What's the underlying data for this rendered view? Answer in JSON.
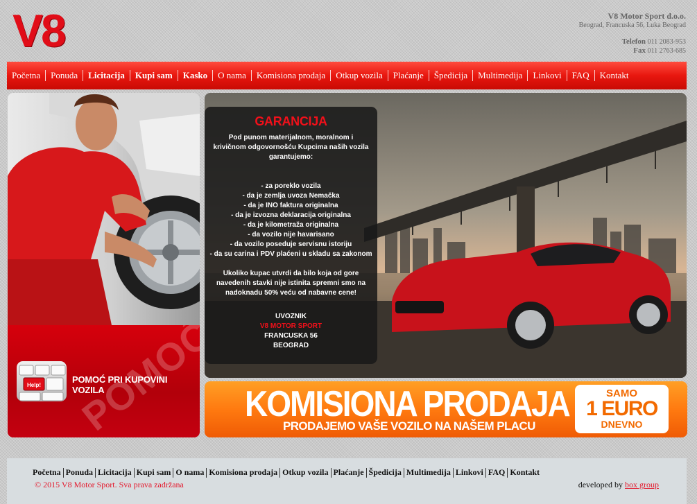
{
  "header": {
    "logo": "V8",
    "company_name": "V8 Motor Sport d.o.o.",
    "address": "Beograd, Francuska 56, Luka Beograd",
    "phone_label": "Telefon",
    "phone": "011 2083-953",
    "fax_label": "Fax",
    "fax": "011 2763-685"
  },
  "nav": {
    "items": [
      "Početna",
      "Ponuda",
      "Licitacija",
      "Kupi sam",
      "Kasko",
      "O nama",
      "Komisiona prodaja",
      "Otkup vozila",
      "Plaćanje",
      "Špedicija",
      "Multimedija",
      "Linkovi",
      "FAQ",
      "Kontakt"
    ]
  },
  "pomoc": {
    "bg_word": "POMOĆ",
    "keyboard_key": "Help!",
    "label": "POMOĆ PRI KUPOVINI VOZILA"
  },
  "garancija": {
    "title": "GARANCIJA",
    "intro": "Pod punom materijalnom, moralnom i krivičnom odgovornošću Kupcima naših vozila garantujemo:",
    "list": [
      "- za poreklo vozila",
      "- da je zemlja uvoza Nemačka",
      "- da je INO faktura originalna",
      "- da je izvozna deklaracija originalna",
      "- da je kilometraža originalna",
      "- da vozilo nije havarisano",
      "- da vozilo poseduje servisnu istoriju",
      "- da su carina i PDV plaćeni u skladu sa zakonom"
    ],
    "claim": "Ukoliko kupac utvrdi da bilo koja od gore navedenih stavki nije istinita spremni smo na nadoknadu 50% veću od nabavne cene!",
    "importer_label": "UVOZNIK",
    "importer_name": "V8 MOTOR SPORT",
    "importer_street": "FRANCUSKA 56",
    "importer_city": "BEOGRAD"
  },
  "komisiona": {
    "title": "KOMISIONA PRODAJA",
    "subtitle": "PRODAJEMO VAŠE VOZILO NA NAŠEM PLACU",
    "price_top": "SAMO",
    "price_value": "1 EURO",
    "price_bottom": "DNEVNO"
  },
  "footer": {
    "nav": [
      "Početna",
      "Ponuda",
      "Licitacija",
      "Kupi sam",
      "O nama",
      "Komisiona prodaja",
      "Otkup vozila",
      "Plaćanje",
      "Špedicija",
      "Multimedija",
      "Linkovi",
      "FAQ",
      "Kontakt"
    ],
    "copyright": "© 2015 V8 Motor Sport. Sva prava zadržana",
    "developed_by": "developed by",
    "developer": "box group"
  },
  "colors": {
    "brand_red": "#e10d18",
    "nav_red": "#e8170f",
    "banner_orange": "#ff7a10"
  }
}
